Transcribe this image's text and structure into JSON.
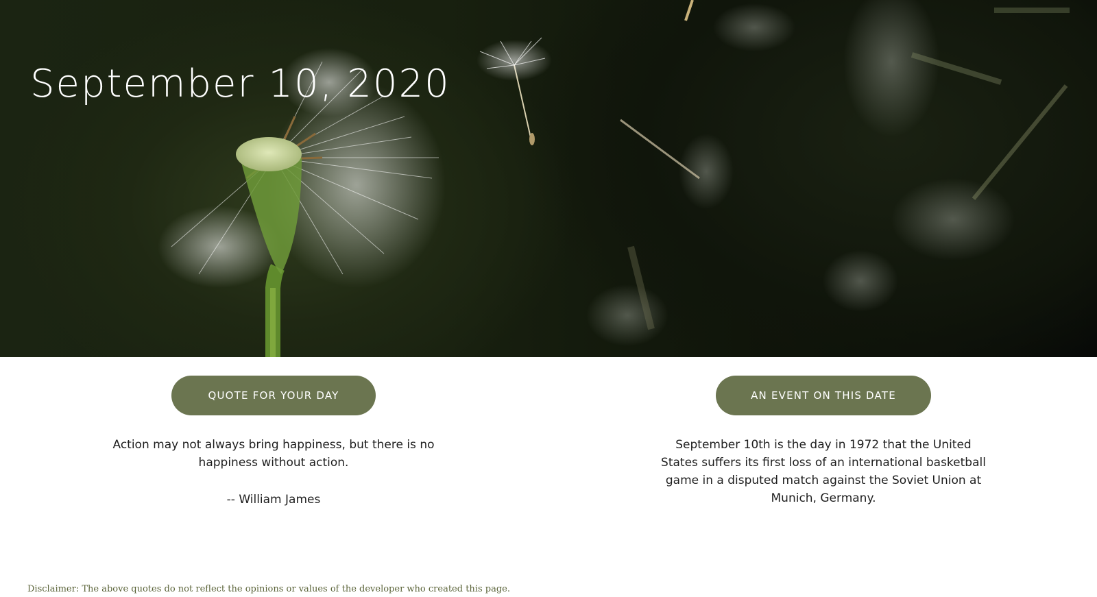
{
  "hero": {
    "date": "September 10, 2020",
    "image_subject": "dandelion-seeds-photo"
  },
  "quote_section": {
    "button_label": "QUOTE FOR YOUR DAY",
    "quote": "Action may not always bring happiness, but there is no happiness without action.",
    "author": "-- William James"
  },
  "event_section": {
    "button_label": "AN EVENT ON THIS DATE",
    "text": "September 10th is the day in 1972 that the United States suffers its first loss of an international basketball game in a disputed match against the Soviet Union at Munich, Germany."
  },
  "footer": {
    "disclaimer": "Disclaimer: The above quotes do not reflect the opinions or values of the developer who created this page."
  },
  "colors": {
    "accent": "#6b7550",
    "hero_dark": "#1b2412",
    "disclaimer": "#5a6338"
  }
}
